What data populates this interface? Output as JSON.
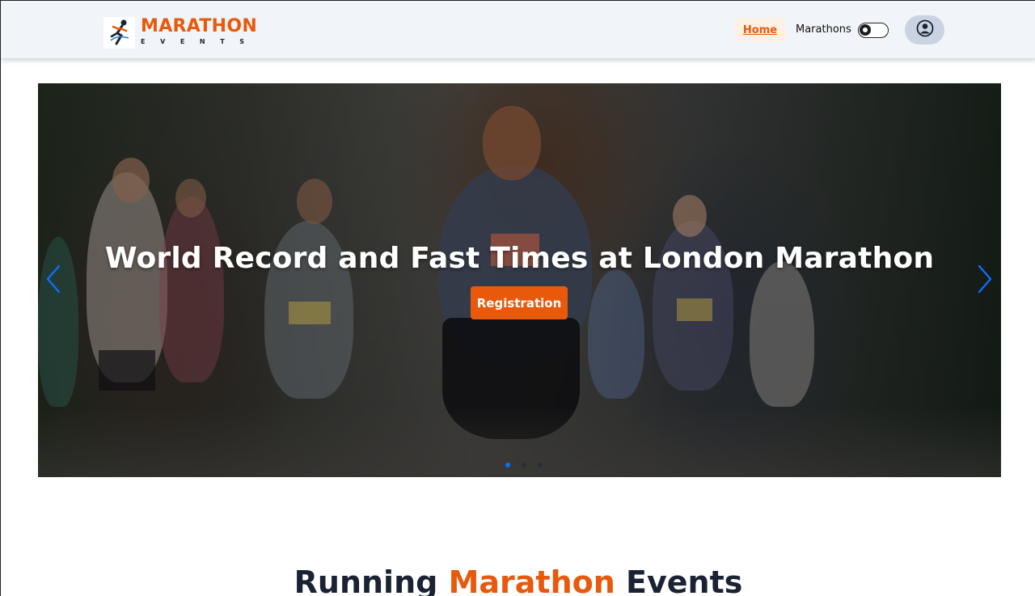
{
  "brand": {
    "title": "MARATHON",
    "subtitle": "EVENTS",
    "logo_icon": "runner-logo-icon"
  },
  "nav": {
    "home_label": "Home",
    "marathons_label": "Marathons",
    "theme_toggle_icon": "toggle-switch-icon",
    "profile_icon": "user-circle-icon"
  },
  "hero": {
    "title": "World Record and Fast Times at London Marathon",
    "button_label": "Registration",
    "prev_icon": "chevron-left-icon",
    "next_icon": "chevron-right-icon",
    "slide_count": 3,
    "active_slide": 1
  },
  "section": {
    "title_part1": "Running ",
    "title_accent": "Marathon",
    "title_part2": " Events"
  },
  "colors": {
    "accent": "#e8590c",
    "dark": "#1a2233",
    "navbar_bg": "#f1f4f8",
    "carousel_control": "#0d6efd"
  }
}
